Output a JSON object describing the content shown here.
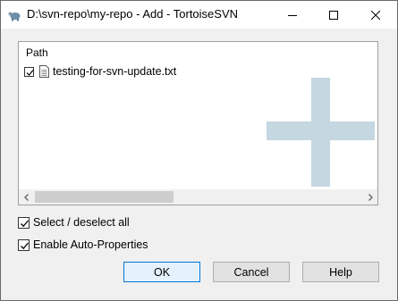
{
  "window": {
    "title": "D:\\svn-repo\\my-repo - Add - TortoiseSVN",
    "icon": "tortoise-icon"
  },
  "caption_buttons": {
    "minimize_icon": "minimize-icon",
    "maximize_icon": "maximize-icon",
    "close_icon": "close-icon"
  },
  "file_list": {
    "column_header": "Path",
    "rows": [
      {
        "checked": true,
        "icon": "file-icon",
        "label": "testing-for-svn-update.txt"
      }
    ],
    "watermark_icon": "plus-icon",
    "watermark_color": "#c5d7e1"
  },
  "options": {
    "select_all": {
      "checked": true,
      "label": "Select / deselect all"
    },
    "auto_props": {
      "checked": true,
      "label": "Enable Auto-Properties"
    }
  },
  "buttons": {
    "ok": "OK",
    "cancel": "Cancel",
    "help": "Help"
  },
  "colors": {
    "default_button_border": "#0078d7",
    "default_button_bg": "#e5f1fb"
  }
}
